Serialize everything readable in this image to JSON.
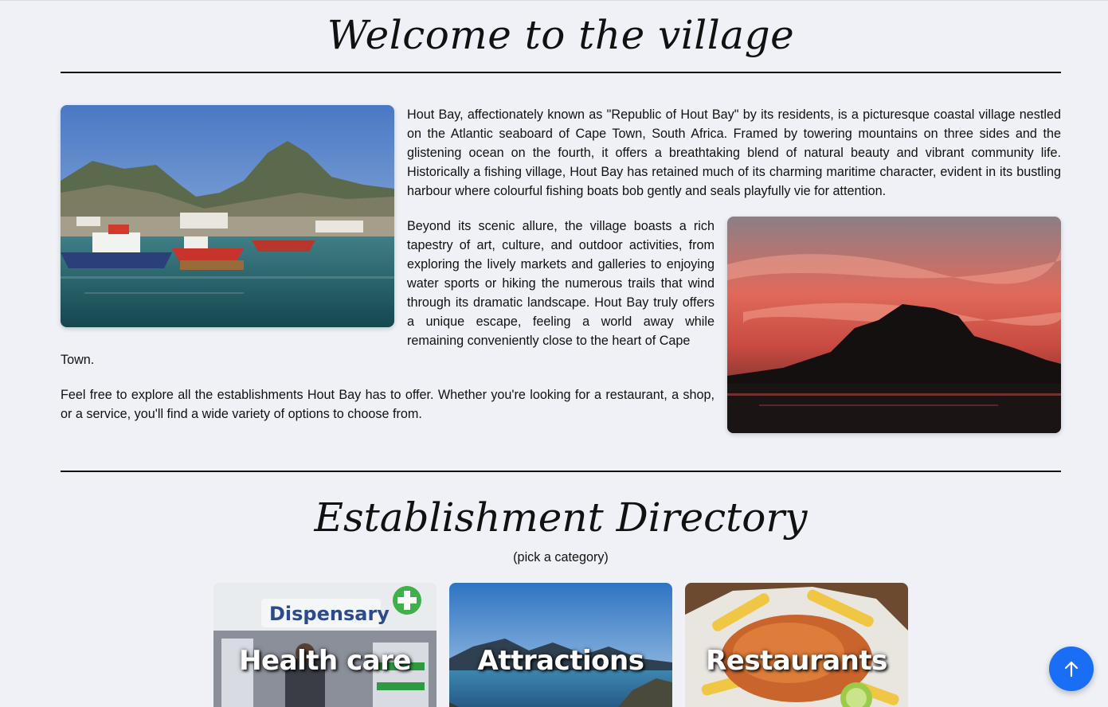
{
  "welcome": {
    "title": "Welcome to the village",
    "paragraph1": "Hout Bay, affectionately known as \"Republic of Hout Bay\" by its residents, is a picturesque coastal village nestled on the Atlantic seaboard of Cape Town, South Africa. Framed by towering mountains on three sides and the glistening ocean on the fourth, it offers a breathtaking blend of natural beauty and vibrant community life. Historically a fishing village, Hout Bay has retained much of its charming maritime character, evident in its bustling harbour where colourful fishing boats bob gently and seals playfully vie for attention.",
    "paragraph2": "Beyond its scenic allure, the village boasts a rich tapestry of art, culture, and outdoor activities, from exploring the lively markets and galleries to enjoying water sports or hiking the numerous trails that wind through its dramatic landscape. Hout Bay truly offers a unique escape, feeling a world away while remaining conveniently close to the heart of Cape",
    "paragraph2_tail": "Town.",
    "paragraph3": "Feel free to explore all the establishments Hout Bay has to offer. Whether you're looking for a restaurant, a shop, or a service, you'll find a wide variety of options to choose from."
  },
  "directory": {
    "title": "Establishment Directory",
    "subtitle": "(pick a category)",
    "categories": [
      {
        "label": "Health care"
      },
      {
        "label": "Attractions"
      },
      {
        "label": "Restaurants"
      }
    ]
  },
  "images": {
    "harbour": "harbour-photo",
    "sunset": "sunset-mountain-photo"
  },
  "back_to_top": {
    "icon": "arrow-up-icon",
    "color": "#1a6ef5"
  },
  "colors": {
    "background": "#eff1f6",
    "text": "#111111",
    "accent": "#1a6ef5"
  }
}
